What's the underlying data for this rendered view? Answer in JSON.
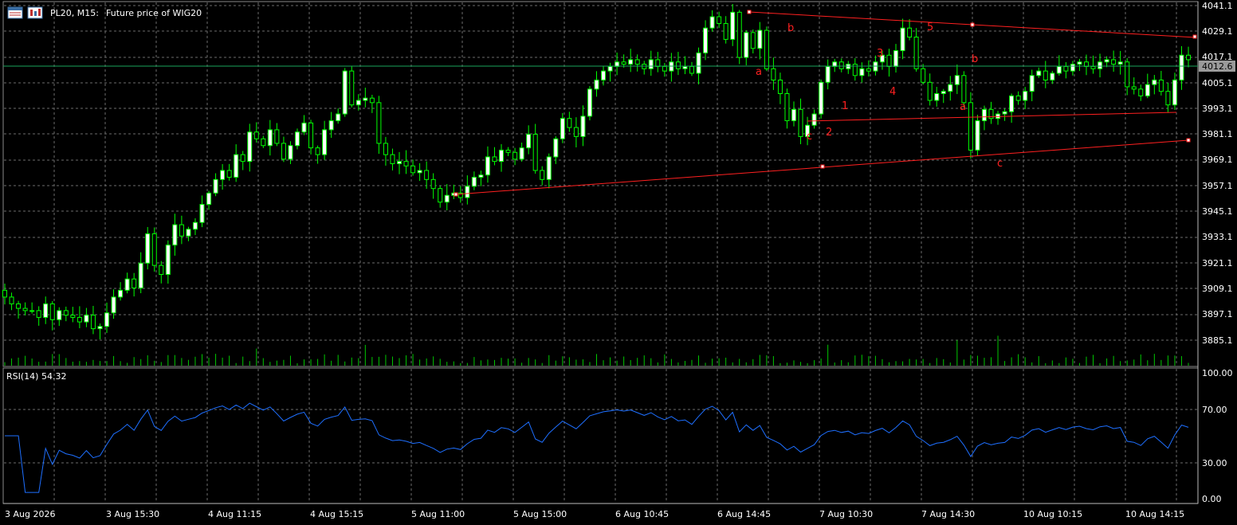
{
  "header": {
    "symbol_timeframe": "PL20, M15:",
    "description": "Future price of WIG20",
    "menu_icon": "chart-window-menu-icon",
    "chart_icon": "candlestick-chart-icon"
  },
  "colors": {
    "background": "#000000",
    "grid": "#6b6b6b",
    "bull_candle": "#ffffff",
    "candle_outline": "#00ff00",
    "volume": "#00c800",
    "bid_line": "#1aa35c",
    "trendline": "#ff2020",
    "wave_label": "#ff2020",
    "rsi_line": "#1e6fff",
    "price_badge_bg": "#9a9a9a"
  },
  "price_axis": {
    "ticks": [
      "4041.1",
      "4029.1",
      "4017.1",
      "4005.1",
      "3993.1",
      "3981.1",
      "3969.1",
      "3957.1",
      "3945.1",
      "3933.1",
      "3921.1",
      "3909.1",
      "3897.1",
      "3885.1"
    ],
    "current_price": "4012.6"
  },
  "rsi": {
    "label": "RSI(14) 54.32",
    "ticks": [
      "100.00",
      "70.00",
      "30.00",
      "0.00"
    ]
  },
  "time_axis": {
    "labels": [
      "3 Aug 2026",
      "3 Aug 15:30",
      "4 Aug 11:15",
      "4 Aug 15:15",
      "5 Aug 11:00",
      "5 Aug 15:00",
      "6 Aug 10:45",
      "6 Aug 14:45",
      "7 Aug 10:30",
      "7 Aug 14:30",
      "10 Aug 10:15",
      "10 Aug 14:15"
    ]
  },
  "wave_labels": [
    "a",
    "b",
    "c",
    "1",
    "2",
    "3",
    "4",
    "5",
    "a",
    "b",
    "c"
  ],
  "chart_data": {
    "type": "candlestick",
    "title": "PL20, M15: Future price of WIG20",
    "ylim": [
      3882,
      4042
    ],
    "current_price": 4012.6,
    "close": [
      3912,
      3909,
      3907,
      3906,
      3906,
      3903,
      3909,
      3902,
      3906,
      3904,
      3903,
      3901,
      3904,
      3898,
      3899,
      3905,
      3912,
      3915,
      3920,
      3916,
      3927,
      3940,
      3926,
      3922,
      3935,
      3944,
      3939,
      3942,
      3945,
      3953,
      3958,
      3964,
      3968,
      3965,
      3975,
      3972,
      3985,
      3982,
      3979,
      3986,
      3980,
      3973,
      3979,
      3985,
      3989,
      3978,
      3975,
      3986,
      3990,
      3993,
      4012,
      3997,
      3999,
      4000,
      3998,
      3980,
      3975,
      3971,
      3972,
      3970,
      3967,
      3968,
      3964,
      3960,
      3954,
      3957,
      3958,
      3956,
      3961,
      3965,
      3966,
      3974,
      3972,
      3977,
      3976,
      3973,
      3978,
      3984,
      3968,
      3964,
      3974,
      3982,
      3991,
      3987,
      3983,
      3992,
      4004,
      4008,
      4012,
      4014,
      4016,
      4015,
      4017,
      4015,
      4013,
      4017,
      4014,
      4012,
      4016,
      4013,
      4014,
      4011,
      4020,
      4031,
      4036,
      4033,
      4026,
      4038,
      4018,
      4029,
      4022,
      4030,
      4013,
      4008,
      4002,
      3990,
      3995,
      3983,
      3988,
      3993,
      4007,
      4014,
      4016,
      4013,
      4015,
      4010,
      4013,
      4012,
      4016,
      4019,
      4014,
      4021,
      4031,
      4027,
      4013,
      4007,
      3999,
      4002,
      4003,
      4006,
      4010,
      3998,
      3977,
      3990,
      3995,
      3991,
      3993,
      3994,
      4001,
      3999,
      4003,
      4010,
      4012,
      4008,
      4011,
      4014,
      4012,
      4015,
      4016,
      4014,
      4013,
      4016,
      4017,
      4015,
      4016,
      4005,
      4004,
      4001,
      4006,
      4008,
      4003,
      3997,
      4008,
      4019,
      4017
    ]
  }
}
